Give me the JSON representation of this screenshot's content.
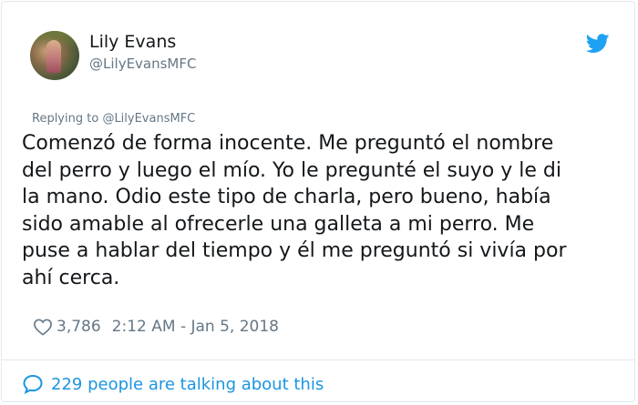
{
  "author": {
    "display_name": "Lily Evans",
    "handle": "@LilyEvansMFC",
    "avatar_icon": "profile-photo"
  },
  "reply": {
    "prefix": "Replying to ",
    "mention": "@LilyEvansMFC"
  },
  "tweet": {
    "lines": [
      "Comenzó de forma inocente. Me preguntó el nombre",
      "del perro y luego el mío. Yo le pregunté el suyo y le di",
      "la mano. Odio este tipo de charla, pero bueno, había",
      "sido amable al ofrecerle una galleta a mi perro. Me",
      "puse a hablar del tiempo y él me preguntó si vivía por",
      "ahí cerca."
    ]
  },
  "meta": {
    "likes": "3,786",
    "timestamp": "2:12 AM - Jan 5, 2018",
    "heart_icon": "heart-outline"
  },
  "conversation": {
    "label": "229 people are talking about this",
    "icon": "speech-bubble"
  },
  "colors": {
    "brand": "#1da1f2",
    "link": "#1b95e0",
    "secondary_text": "#657786",
    "border": "#e1e8ed"
  }
}
